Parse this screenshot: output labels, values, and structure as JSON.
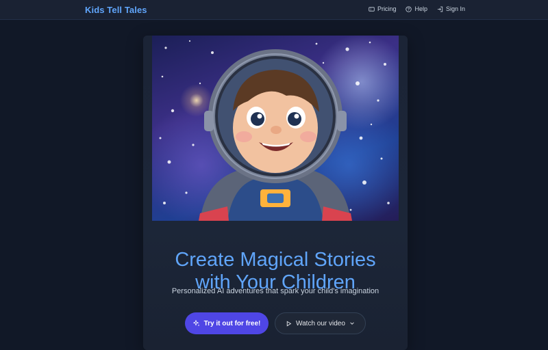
{
  "header": {
    "brand": "Kids Tell Tales",
    "nav": [
      {
        "label": "Pricing",
        "icon": "ticket-icon"
      },
      {
        "label": "Help",
        "icon": "help-circle-icon"
      },
      {
        "label": "Sign In",
        "icon": "sign-in-icon"
      }
    ]
  },
  "hero": {
    "image": "cartoon-astronaut-child-in-space",
    "headline_line1": "Create Magical Stories",
    "headline_line2": "with Your Children",
    "subtitle": "Personalized AI adventures that spark your child's imagination",
    "primary_cta": "Try it out for free!",
    "secondary_cta": "Watch our video"
  },
  "colors": {
    "background": "#111827",
    "accent": "#60a5fa",
    "primary_button": "#4f46e5"
  }
}
